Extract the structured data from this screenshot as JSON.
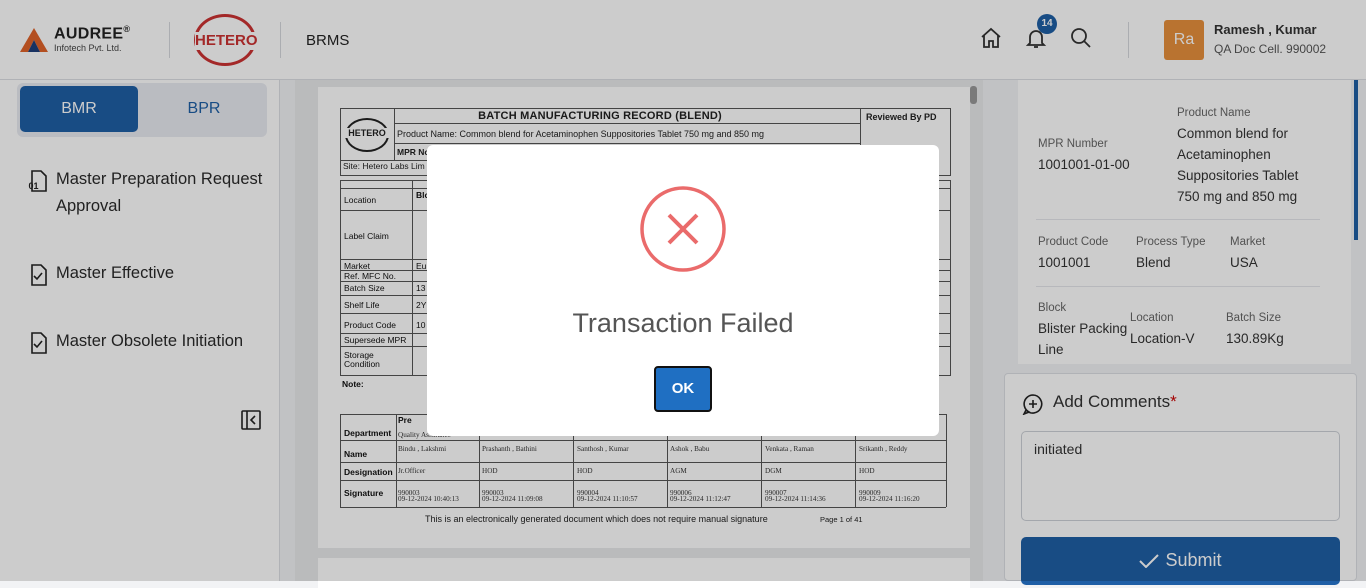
{
  "header": {
    "brand": "AUDREE",
    "brand_reg": "®",
    "brand_sub": "Infotech Pvt. Ltd.",
    "partner_logo": "HETERO",
    "app_name": "BRMS",
    "notification_count": "14",
    "user_initials": "Ra",
    "user_name": "Ramesh , Kumar",
    "user_dept": "QA Doc Cell. 990002"
  },
  "sidebar": {
    "tabs": [
      "BMR",
      "BPR"
    ],
    "items": [
      {
        "label": "Master Preparation Request Approval",
        "icon": "document-01-icon"
      },
      {
        "label": "Master Effective",
        "icon": "document-check-icon"
      },
      {
        "label": "Master Obsolete Initiation",
        "icon": "document-check-icon"
      }
    ]
  },
  "document": {
    "title": "BATCH MANUFACTURING RECORD (BLEND)",
    "reviewed": "Reviewed By PD",
    "logo": "HETERO",
    "product_line": "Product Name: Common blend for Acetaminophen Suppositories Tablet 750 mg and 850 mg",
    "mpr_no": "MPR No",
    "site": "Site: Hetero Labs Lim",
    "rows": [
      {
        "label": "Location",
        "value": "Blo"
      },
      {
        "label": "Label Claim",
        "value": ""
      },
      {
        "label": "Market",
        "value": "Eu"
      },
      {
        "label": "Ref. MFC No.",
        "value": ""
      },
      {
        "label": "Batch Size",
        "value": "13"
      },
      {
        "label": "Shelf Life",
        "value": "2Y"
      },
      {
        "label": "Product Code",
        "value": "10"
      },
      {
        "label": "Supersede MPR",
        "value": ""
      },
      {
        "label": "Storage Condition",
        "value": ""
      }
    ],
    "note": "Note:",
    "sig_head": "Pre",
    "sig_row_labels": [
      "Department",
      "Name",
      "Designation",
      "Signature"
    ],
    "sig_columns": [
      {
        "dept": "Quality Assurance",
        "name": "Bindu , Lakshmi",
        "desig": "Jr.Officer",
        "code": "990003",
        "time": "09-12-2024 10:40:13"
      },
      {
        "dept": "",
        "name": "Prashanth , Bathini",
        "desig": "HOD",
        "code": "990003",
        "time": "09-12-2024 11:09:08"
      },
      {
        "dept": "",
        "name": "Santhosh , Kumar",
        "desig": "HOD",
        "code": "990004",
        "time": "09-12-2024 11:10:57"
      },
      {
        "dept": "",
        "name": "Ashok , Babu",
        "desig": "AGM",
        "code": "990006",
        "time": "09-12-2024 11:12:47"
      },
      {
        "dept": "",
        "name": "Venkata , Raman",
        "desig": "DGM",
        "code": "990007",
        "time": "09-12-2024 11:14:36"
      },
      {
        "dept": "",
        "name": "Srikanth , Reddy",
        "desig": "HOD",
        "code": "990009",
        "time": "09-12-2024 11:16:20"
      }
    ],
    "footer": "This is an electronically generated document which does not require manual signature",
    "page_no": "Page 1 of 41"
  },
  "details": {
    "mpr_number_label": "MPR Number",
    "mpr_number": "1001001-01-00",
    "product_name_label": "Product Name",
    "product_name": "Common blend for Acetaminophen Suppositories Tablet 750 mg and 850 mg",
    "product_code_label": "Product Code",
    "product_code": "1001001",
    "process_type_label": "Process Type",
    "process_type": "Blend",
    "market_label": "Market",
    "market": "USA",
    "block_label": "Block",
    "block": "Blister Packing Line",
    "location_label": "Location",
    "location": "Location-V",
    "batch_size_label": "Batch Size",
    "batch_size": "130.89Kg"
  },
  "comments": {
    "title": "Add Comments",
    "required_mark": "*",
    "value": "initiated",
    "submit_label": "Submit"
  },
  "modal": {
    "message": "Transaction Failed",
    "ok_label": "OK",
    "icon": "error-x-circle-icon",
    "icon_color": "#ea6b6b"
  },
  "colors": {
    "primary": "#1f5fa6",
    "brand_orange": "#e8903c",
    "hetero_red": "#cc3333"
  }
}
